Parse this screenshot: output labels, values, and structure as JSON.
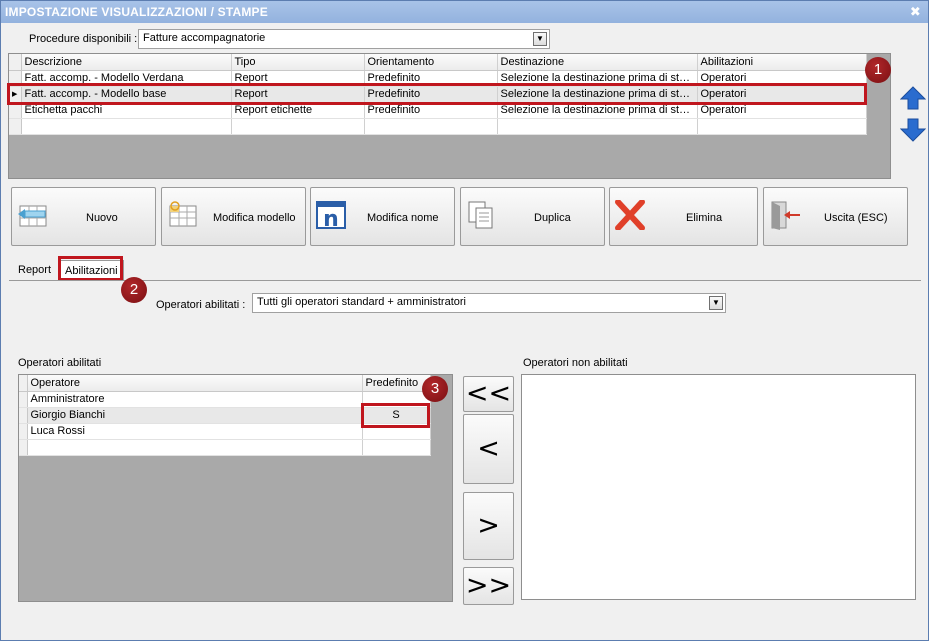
{
  "window": {
    "title": "IMPOSTAZIONE VISUALIZZAZIONI / STAMPE",
    "close_glyph": "✖"
  },
  "procedure": {
    "label": "Procedure disponibili :",
    "value": "Fatture accompagnatorie"
  },
  "procedures_grid": {
    "columns": [
      "Descrizione",
      "Tipo",
      "Orientamento",
      "Destinazione",
      "Abilitazioni"
    ],
    "rows": [
      [
        "Fatt. accomp. - Modello Verdana",
        "Report",
        "Predefinito",
        "Selezione la destinazione prima di stampare",
        "Operatori"
      ],
      [
        "Fatt. accomp. - Modello base",
        "Report",
        "Predefinito",
        "Selezione la destinazione prima di stampare",
        "Operatori"
      ],
      [
        "Etichetta pacchi",
        "Report etichette",
        "Predefinito",
        "Selezione la destinazione prima di stampare",
        "Operatori"
      ]
    ],
    "selected_row_marker": "▶"
  },
  "badges": {
    "b1": "1",
    "b2": "2",
    "b3": "3"
  },
  "toolbar": {
    "nuovo": "Nuovo",
    "modifica_modello": "Modifica modello",
    "modifica_nome": "Modifica nome",
    "duplica": "Duplica",
    "elimina": "Elimina",
    "uscita": "Uscita (ESC)"
  },
  "tabs": {
    "report": "Report",
    "abilitazioni": "Abilitazioni"
  },
  "operatori_abilitati_combo": {
    "label": "Operatori abilitati :",
    "value": "Tutti gli operatori standard + amministratori"
  },
  "operatori_abilitati": {
    "title": "Operatori abilitati",
    "columns": [
      "Operatore",
      "Predefinito"
    ],
    "rows": [
      [
        "Amministratore",
        ""
      ],
      [
        "Giorgio Bianchi",
        "S"
      ],
      [
        "Luca Rossi",
        ""
      ]
    ]
  },
  "operatori_non_abilitati": {
    "title": "Operatori non abilitati"
  },
  "move_buttons": {
    "all_left": "<<",
    "left": "<",
    "right": ">",
    "all_right": ">>"
  },
  "colors": {
    "accent_red": "#c0161e",
    "arrow_blue": "#2a6ccf",
    "title_blue": "#9bb8e2"
  }
}
